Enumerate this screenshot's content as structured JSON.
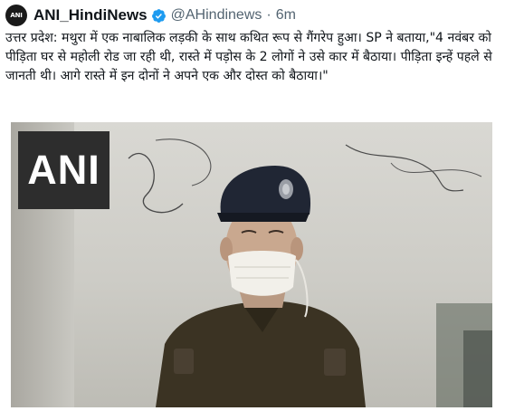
{
  "author": {
    "name": "ANI_HindiNews",
    "handle": "@AHindinews",
    "separator": "·",
    "time": "6m",
    "avatar_text": "ANI"
  },
  "tweet_text": "उत्तर प्रदेश: मथुरा में एक नाबालिक लड़की के साथ कथित रूप से गैंगरेप हुआ। SP ने बताया,\"4 नवंबर को पीड़िता घर से महोली रोड जा रही थी, रास्ते में पड़ोस के 2 लोगों ने उसे कार में बैठाया। पीड़िता इन्हें पहले से जानती थी। आगे रास्ते में इन दोनों ने अपने एक और दोस्त को बैठाया।\"",
  "media": {
    "watermark": "ANI"
  },
  "colors": {
    "verified": "#1d9bf0",
    "secondary_text": "#536471",
    "uniform": "#3b3323",
    "cap": "#202634"
  }
}
